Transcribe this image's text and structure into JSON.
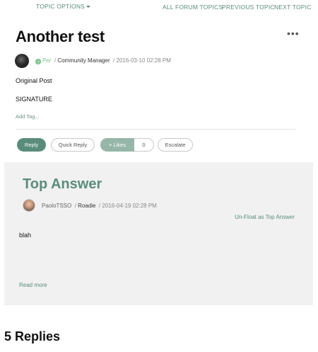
{
  "topnav": {
    "topic_options": "TOPIC OPTIONS",
    "all_topics": "ALL FORUM TOPICS",
    "previous": "PREVIOUS TOPIC",
    "next": "NEXT TOPIC"
  },
  "post": {
    "title": "Another test",
    "more": "•••",
    "author": "Per",
    "rank": "Community Manager",
    "date": "2016-03-10",
    "time": "02:28 PM",
    "body": "Original Post",
    "signature": "SIGNATURE",
    "add_tag": "Add Tag..."
  },
  "actions": {
    "reply": "Reply",
    "quick_reply": "Quick Reply",
    "likes": "+ Likes",
    "likes_count": "0",
    "escalate": "Escalate"
  },
  "answer": {
    "title": "Top Answer",
    "author": "PaoloTSSO",
    "rank": "Roadie",
    "date": "2016-04-19",
    "time": "02:28 PM",
    "unfloat": "Un-Float as Top Answer",
    "body": "blah",
    "read_more": "Read more"
  },
  "replies_heading": "5 Replies",
  "colors": {
    "accent": "#5a8c7c",
    "online": "#8fd19e",
    "panel": "#f1f1f1"
  }
}
